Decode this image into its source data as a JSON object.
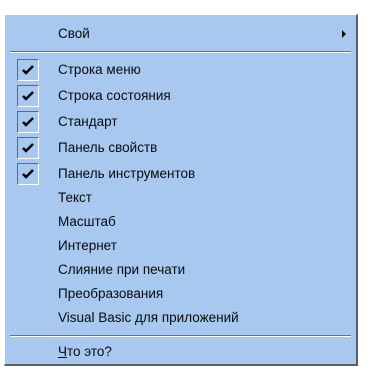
{
  "menu": {
    "submenu_item": {
      "label": "Свой",
      "arrow_icon": "chevron-right-icon"
    },
    "toolbars": [
      {
        "label": "Строка меню",
        "checked": true
      },
      {
        "label": "Строка состояния",
        "checked": true
      },
      {
        "label": "Стандарт",
        "checked": true
      },
      {
        "label": "Панель свойств",
        "checked": true
      },
      {
        "label": "Панель инструментов",
        "checked": true
      },
      {
        "label": "Текст",
        "checked": false
      },
      {
        "label": "Масштаб",
        "checked": false
      },
      {
        "label": "Интернет",
        "checked": false
      },
      {
        "label": "Слияние при печати",
        "checked": false
      },
      {
        "label": "Преобразования",
        "checked": false
      },
      {
        "label": "Visual Basic для приложений",
        "checked": false
      }
    ],
    "help_item": {
      "accel": "Ч",
      "rest": "то это?"
    },
    "colors": {
      "background": "#a8c8f0",
      "text": "#0a0a0a",
      "check": "#000000"
    }
  }
}
